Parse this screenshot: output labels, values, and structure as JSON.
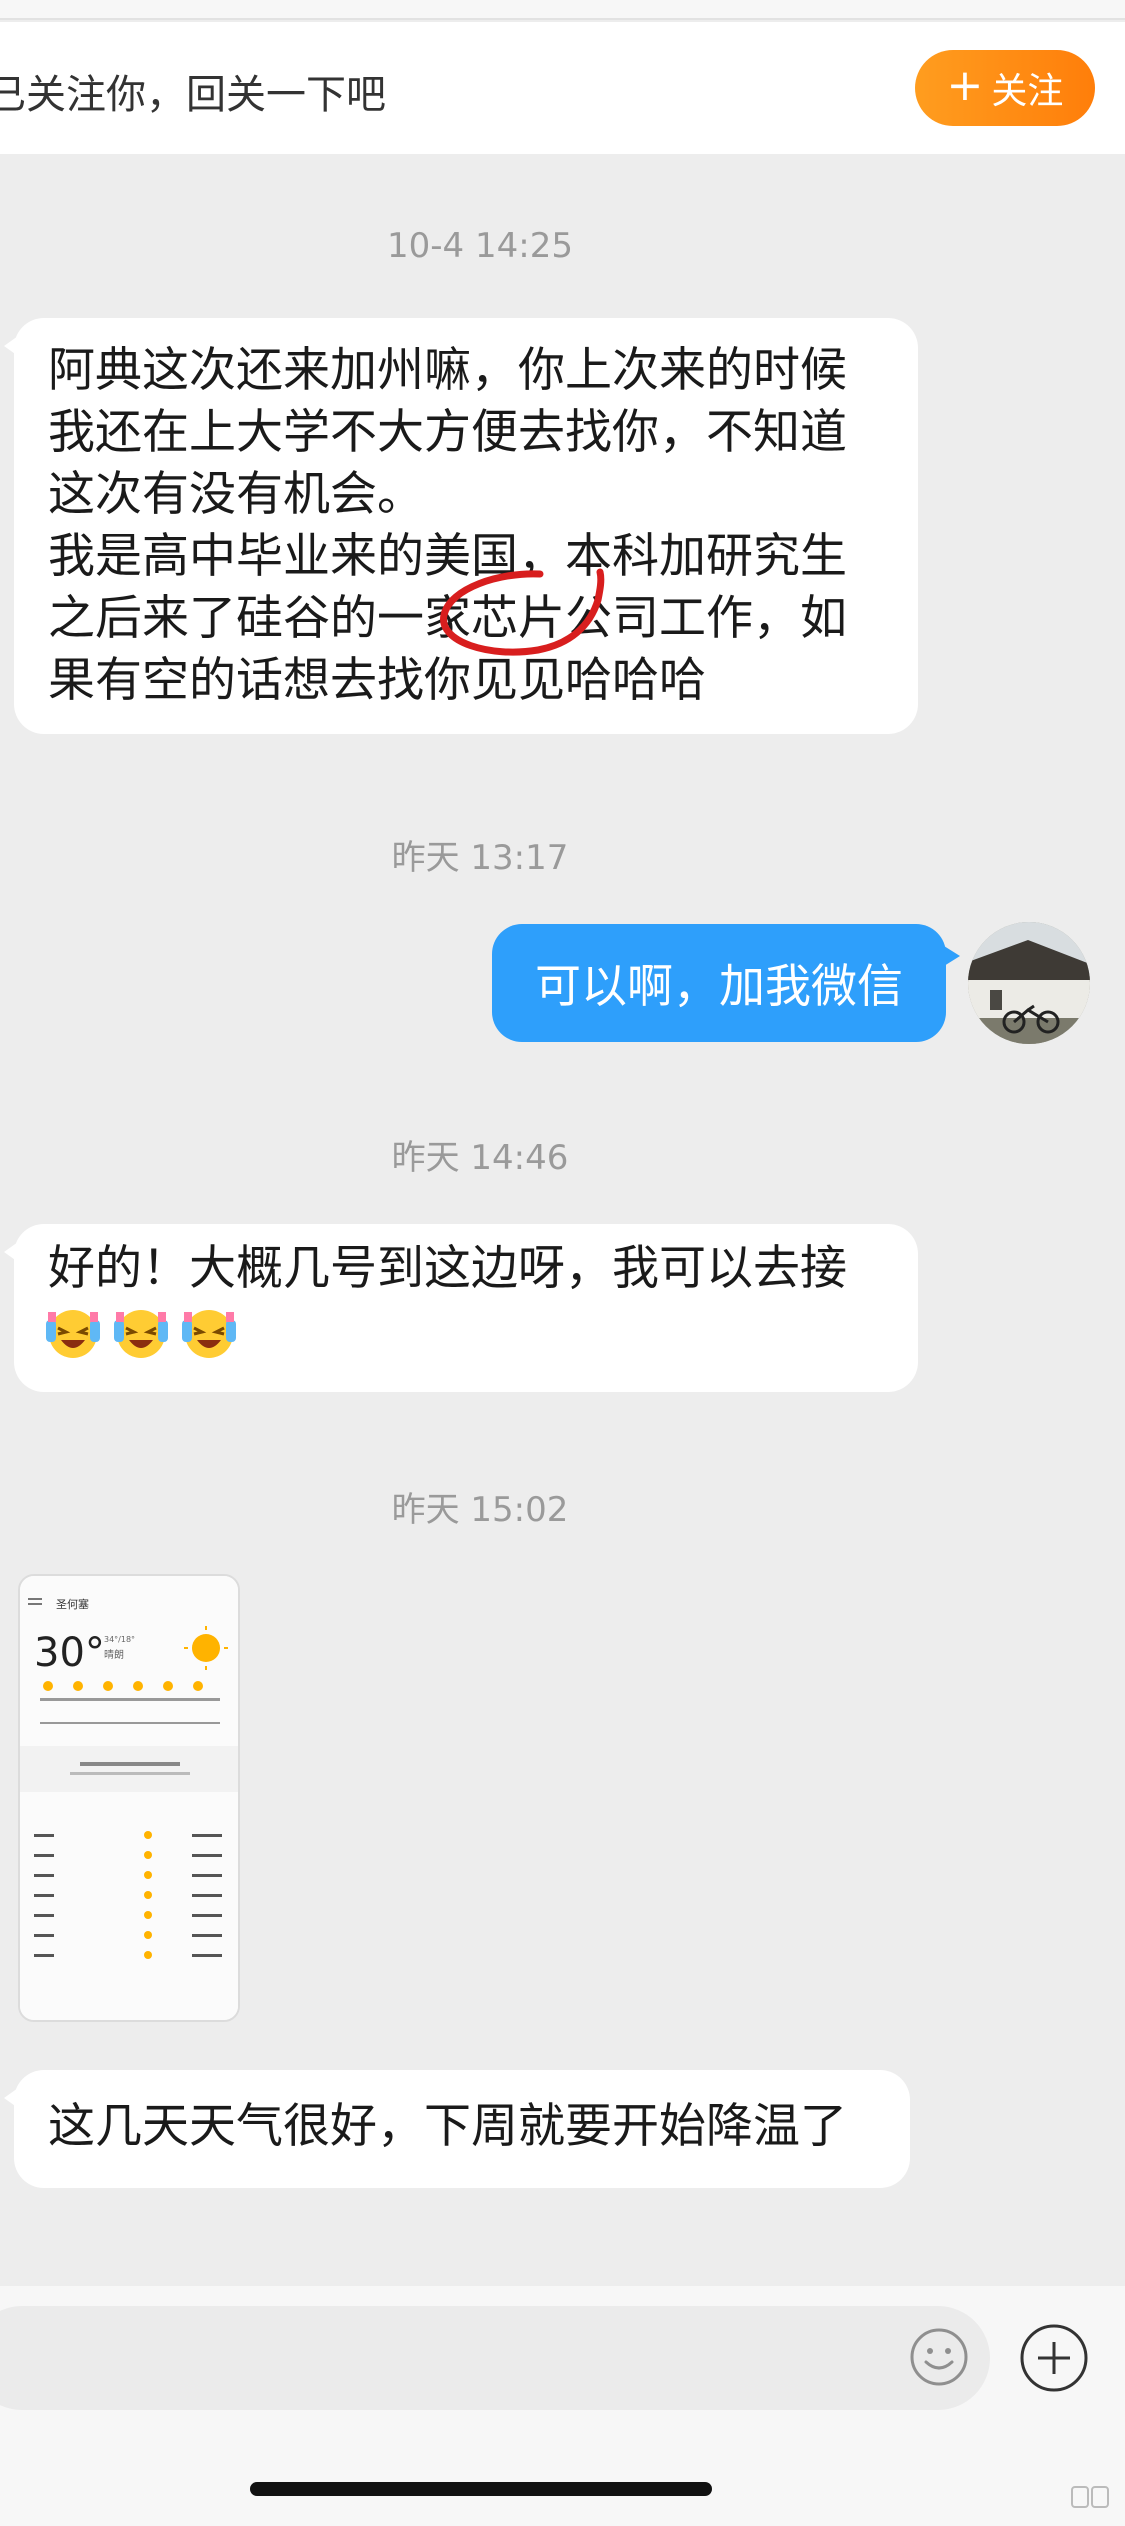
{
  "follow_bar": {
    "text": "已关注你，回关一下吧",
    "button_label": "关注",
    "button_icon": "plus-icon"
  },
  "messages": [
    {
      "timestamp": "10-4 14:25",
      "direction": "incoming",
      "text": "阿典这次还来加州嘛，你上次来的时候\n我还在上大学不大方便去找你，不知道\n这次有没有机会。\n我是高中毕业来的美国，本科加研究生\n之后来了硅谷的一家芯片公司工作，如\n果有空的话想去找你见见哈哈哈"
    },
    {
      "timestamp": "昨天 13:17",
      "direction": "outgoing",
      "text": "可以啊，加我微信"
    },
    {
      "timestamp": "昨天 14:46",
      "direction": "incoming",
      "text": "好的！大概几号到这边呀，我可以去接",
      "emojis": [
        "laughing-crying-emoji",
        "laughing-crying-emoji",
        "laughing-crying-emoji"
      ]
    },
    {
      "timestamp": "昨天 15:02",
      "direction": "incoming",
      "type": "image",
      "thumbnail": {
        "location": "圣何塞",
        "temp": "30°",
        "range": "34°/18°",
        "condition": "晴朗"
      }
    },
    {
      "direction": "incoming",
      "text": "这几天天气很好，下周就要开始降温了"
    }
  ],
  "input": {
    "emoji_icon": "smiley-icon",
    "add_icon": "plus-circle-icon"
  },
  "colors": {
    "accent_orange": "#ff8c14",
    "outgoing_bubble": "#2e9ffb",
    "background": "#ededed",
    "annotation_red": "#d81e1e"
  }
}
